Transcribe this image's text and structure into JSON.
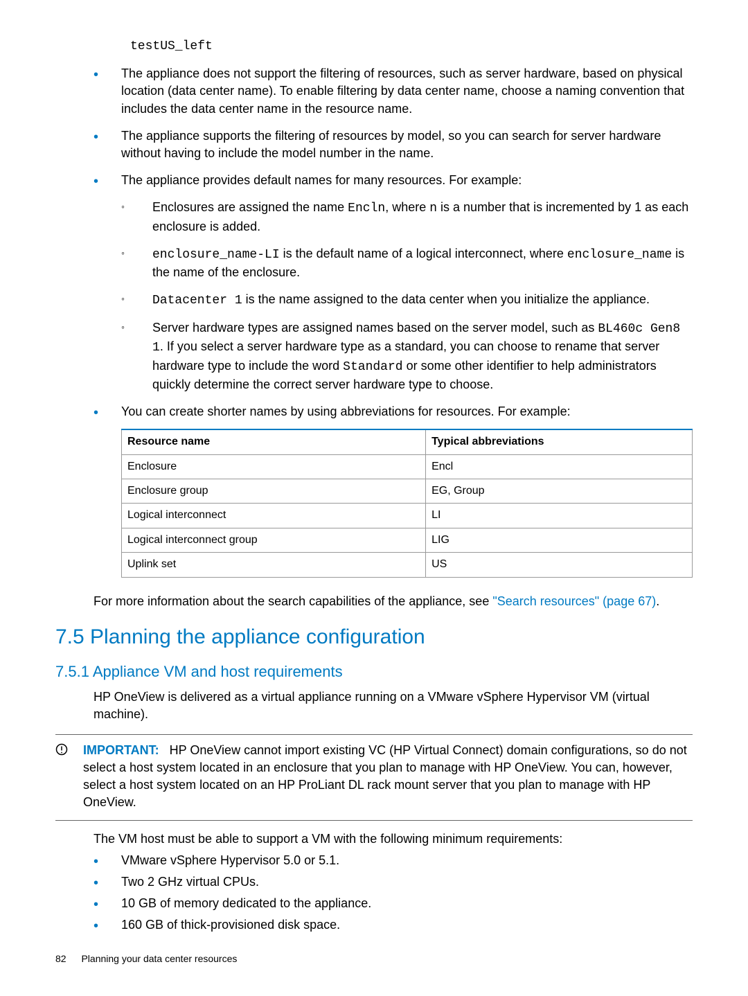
{
  "code_top": "testUS_left",
  "bullets": {
    "b1": "The appliance does not support the filtering of resources, such as server hardware, based on physical location (data center name). To enable filtering by data center name, choose a naming convention that includes the data center name in the resource name.",
    "b2": "The appliance supports the filtering of resources by model, so you can search for server hardware without having to include the model number in the name.",
    "b3": "The appliance provides default names for many resources. For example:",
    "b3_sub": {
      "s1a": "Enclosures are assigned the name ",
      "s1code": "Encln",
      "s1b": ", where ",
      "s1code2": "n",
      "s1c": " is a number that is incremented by 1 as each enclosure is added.",
      "s2code1": "enclosure_name-LI",
      "s2a": " is the default name of a logical interconnect, where ",
      "s2code2": "enclosure_name",
      "s2b": " is the name of the enclosure.",
      "s3code": "Datacenter 1",
      "s3a": " is the name assigned to the data center when you initialize the appliance.",
      "s4a": "Server hardware types are assigned names based on the server model, such as ",
      "s4code1": "BL460c Gen8 1",
      "s4b": ". If you select a server hardware type as a standard, you can choose to rename that server hardware type to include the word ",
      "s4code2": "Standard",
      "s4c": " or some other identifier to help administrators quickly determine the correct server hardware type to choose."
    },
    "b4": "You can create shorter names by using abbreviations for resources. For example:"
  },
  "table": {
    "headers": [
      "Resource name",
      "Typical abbreviations"
    ],
    "rows": [
      [
        "Enclosure",
        "Encl"
      ],
      [
        "Enclosure group",
        "EG, Group"
      ],
      [
        "Logical interconnect",
        "LI"
      ],
      [
        "Logical interconnect group",
        "LIG"
      ],
      [
        "Uplink set",
        "US"
      ]
    ]
  },
  "after_table": {
    "pre": "For more information about the search capabilities of the appliance, see ",
    "link": "\"Search resources\" (page 67)",
    "post": "."
  },
  "sec75": "7.5 Planning the appliance configuration",
  "sec751": "7.5.1 Appliance VM and host requirements",
  "sec751_p1": "HP OneView is delivered as a virtual appliance running on a VMware vSphere Hypervisor VM (virtual machine).",
  "important": {
    "label": "IMPORTANT:",
    "text": "HP OneView cannot import existing VC (HP Virtual Connect) domain configurations, so do not select a host system located in an enclosure that you plan to manage with HP OneView. You can, however, select a host system located on an HP ProLiant DL rack mount server that you plan to manage with HP OneView."
  },
  "vm_host_line": "The VM host must be able to support a VM with the following minimum requirements:",
  "reqs": [
    "VMware vSphere Hypervisor 5.0 or 5.1.",
    "Two 2 GHz virtual CPUs.",
    "10 GB of memory dedicated to the appliance.",
    "160 GB of thick-provisioned disk space."
  ],
  "footer": {
    "page": "82",
    "title": "Planning your data center resources"
  }
}
